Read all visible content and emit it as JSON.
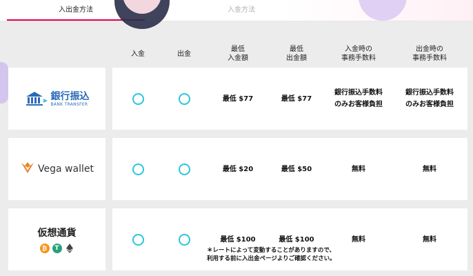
{
  "tabs": {
    "active": "入出金方法",
    "inactive": "入金方法"
  },
  "headers": {
    "deposit": "入金",
    "withdraw": "出金",
    "min_deposit": "最低\n入金額",
    "min_withdraw": "最低\n出金額",
    "deposit_fee": "入金時の\n事務手数料",
    "withdraw_fee": "出金時の\n事務手数料"
  },
  "rows": [
    {
      "method": "bank-transfer",
      "logo_title": "銀行振込",
      "logo_sub": "BANK TRANSFER",
      "min_deposit": "最低 $77",
      "min_withdraw": "最低 $77",
      "deposit_fee": "銀行振込手数料\nのみお客様負担",
      "withdraw_fee": "銀行振込手数料\nのみお客様負担"
    },
    {
      "method": "vega-wallet",
      "logo_title": "Vega wallet",
      "min_deposit": "最低 $20",
      "min_withdraw": "最低 $50",
      "deposit_fee": "無料",
      "withdraw_fee": "無料"
    },
    {
      "method": "crypto",
      "logo_title": "仮想通貨",
      "min_deposit": "最低 $100",
      "min_withdraw": "最低 $100",
      "deposit_fee": "無料",
      "withdraw_fee": "無料"
    }
  ],
  "note": "＊レートによって変動することがありますので、\n利用する前に入出金ページよりご確認ください。",
  "colors": {
    "accent": "#e0004e",
    "circle": "#2bc6dc",
    "bank_blue": "#2a6bb8",
    "vega_orange": "#e8862a"
  },
  "icons": {
    "bank": "bank-building-icon",
    "vega": "vega-crown-icon",
    "coins": [
      "bitcoin-icon",
      "tether-icon",
      "ethereum-icon"
    ]
  }
}
